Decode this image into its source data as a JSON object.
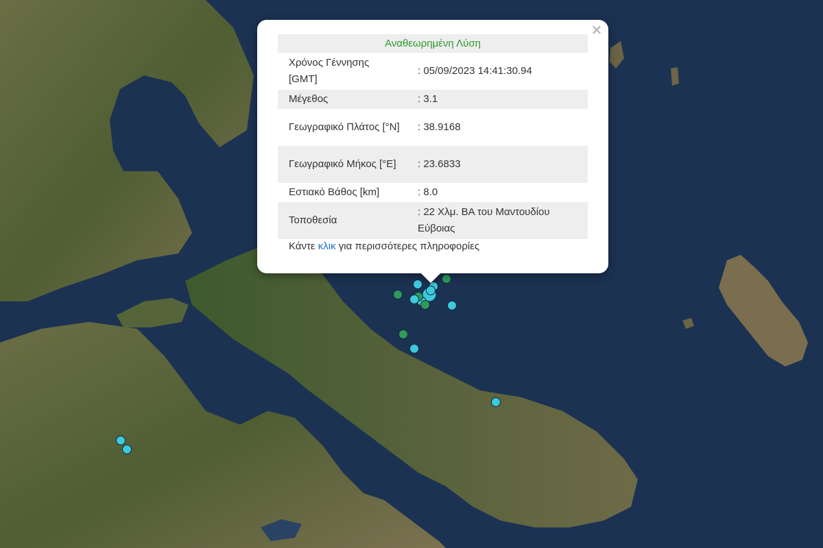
{
  "popup": {
    "title": "Αναθεωρημένη Λύση",
    "close_symbol": "×",
    "rows": [
      {
        "label": "Χρόνος Γέννησης [GMT]",
        "value": ": 05/09/2023 14:41:30.94"
      },
      {
        "label": "Μέγεθος",
        "value": ": 3.1"
      },
      {
        "label": "Γεωγραφικό Πλάτος [°N]",
        "value": ": 38.9168"
      },
      {
        "label": "Γεωγραφικό Μήκος [°E]",
        "value": ": 23.6833"
      },
      {
        "label": "Εστιακό Βάθος [km]",
        "value": ": 8.0"
      },
      {
        "label": "Τοποθεσία",
        "value": ": 22 Χλμ. ΒΑ του Μαντουδίου Εύβοιας"
      }
    ],
    "more_prefix": "Κάντε ",
    "more_link": "κλικ",
    "more_suffix": " για περισσότερες πληροφορίες"
  },
  "colors": {
    "sea": "#1b3152",
    "land": "#5f6a3c",
    "marker_recent": "#3ec9dc",
    "marker_older": "#2f9a5a",
    "title_green": "#2c9a2c"
  },
  "earthquake_markers": [
    {
      "kind": "recent"
    },
    {
      "kind": "recent"
    },
    {
      "kind": "recent"
    },
    {
      "kind": "recent"
    },
    {
      "kind": "older"
    },
    {
      "kind": "older"
    },
    {
      "kind": "older"
    },
    {
      "kind": "older"
    },
    {
      "kind": "recent"
    },
    {
      "kind": "recent"
    },
    {
      "kind": "recent"
    },
    {
      "kind": "older"
    },
    {
      "kind": "recent"
    },
    {
      "kind": "recent"
    },
    {
      "kind": "recent"
    },
    {
      "kind": "recent"
    }
  ]
}
